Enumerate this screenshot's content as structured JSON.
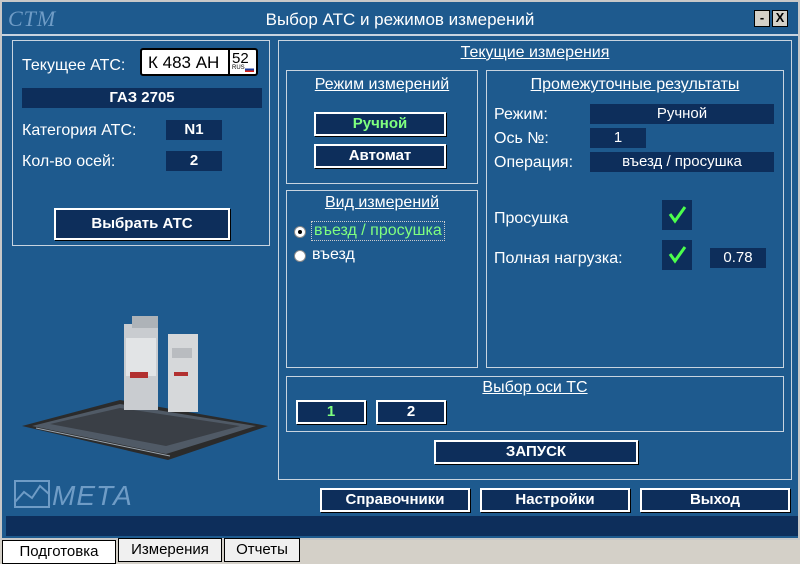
{
  "window": {
    "logo": "СТМ",
    "title": "Выбор АТС и режимов измерений",
    "minimize": "-",
    "close": "X"
  },
  "vehicle": {
    "current_label": "Текущее АТС:",
    "plate_main": "К 483 АН",
    "plate_region": "52",
    "plate_rus": "RUS",
    "model": "ГАЗ 2705",
    "category_label": "Категория АТС:",
    "category": "N1",
    "axles_label": "Кол-во осей:",
    "axles": "2",
    "select_button": "Выбрать АТС"
  },
  "brand_logo": "МЕТА",
  "current": {
    "title": "Текущие измерения",
    "mode": {
      "title": "Режим измерений",
      "manual": "Ручной",
      "auto": "Автомат"
    },
    "kind": {
      "title": "Вид измерений",
      "options": [
        "въезд / просушка",
        "въезд"
      ],
      "selected_index": 0
    },
    "results": {
      "title": "Промежуточные результаты",
      "mode_label": "Режим:",
      "mode_value": "Ручной",
      "axle_label": "Ось №:",
      "axle_value": "1",
      "op_label": "Операция:",
      "op_value": "въезд / просушка",
      "dry_label": "Просушка",
      "load_label": "Полная нагрузка:",
      "load_value": "0.78"
    },
    "axle_select": {
      "title": "Выбор оси ТС",
      "axles": [
        "1",
        "2"
      ]
    },
    "start_button": "ЗАПУСК"
  },
  "footer_buttons": {
    "references": "Справочники",
    "settings": "Настройки",
    "exit": "Выход"
  },
  "tabs": [
    "Подготовка",
    "Измерения",
    "Отчеты"
  ],
  "colors": {
    "background": "#1e5a8e",
    "field": "#0d2e5b",
    "active_text": "#7fff7f",
    "check": "#4cff4c"
  }
}
